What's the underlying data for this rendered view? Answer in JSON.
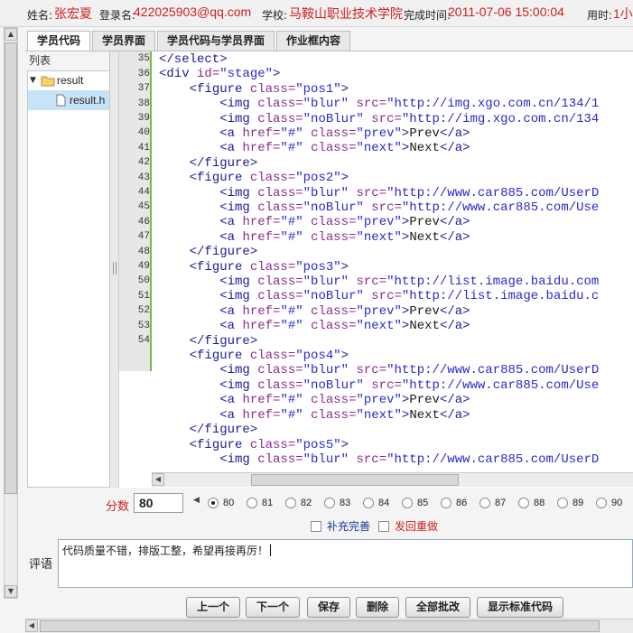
{
  "info_bar": {
    "name_label": "姓名:",
    "name_value": "张宏夏",
    "login_label": "登录名:",
    "login_value": "422025903@qq.com",
    "school_label": "学校:",
    "school_value": "马鞍山职业技术学院",
    "time_label": "完成时间:",
    "time_value": "2011-07-06 15:00:04",
    "duration_label": "用时:",
    "duration_value": "1小"
  },
  "tabs": [
    {
      "label": "学员代码",
      "active": true
    },
    {
      "label": "学员界面",
      "active": false
    },
    {
      "label": "学员代码与学员界面",
      "active": false
    },
    {
      "label": "作业框内容",
      "active": false
    }
  ],
  "file_tree": {
    "title": "列表",
    "folder": "result",
    "file": "result.h"
  },
  "editor": {
    "line_numbers": [
      "35",
      "36",
      "37",
      "38",
      "39",
      "40",
      "41",
      "42",
      "43",
      "44",
      "45",
      "46",
      "47",
      "48",
      "49",
      "50",
      "51",
      "52",
      "53",
      "54"
    ]
  },
  "scoring": {
    "label": "分数",
    "value": "80",
    "options": [
      "80",
      "81",
      "82",
      "83",
      "84",
      "85",
      "86",
      "87",
      "88",
      "89",
      "90"
    ],
    "selected": "80",
    "checkbox_supplement": "补充完善",
    "checkbox_redo": "发回重做"
  },
  "comment": {
    "label": "评语",
    "text": "代码质量不错，排版工整，希望再接再厉！"
  },
  "buttons": {
    "prev": "上一个",
    "next": "下一个",
    "save": "保存",
    "delete": "删除",
    "grade_all": "全部批改",
    "show_standard": "显示标准代码"
  },
  "colors": {
    "accent_red": "#d02020",
    "gutter_border": "#6cbd45",
    "selection": "#c6e3f7"
  }
}
